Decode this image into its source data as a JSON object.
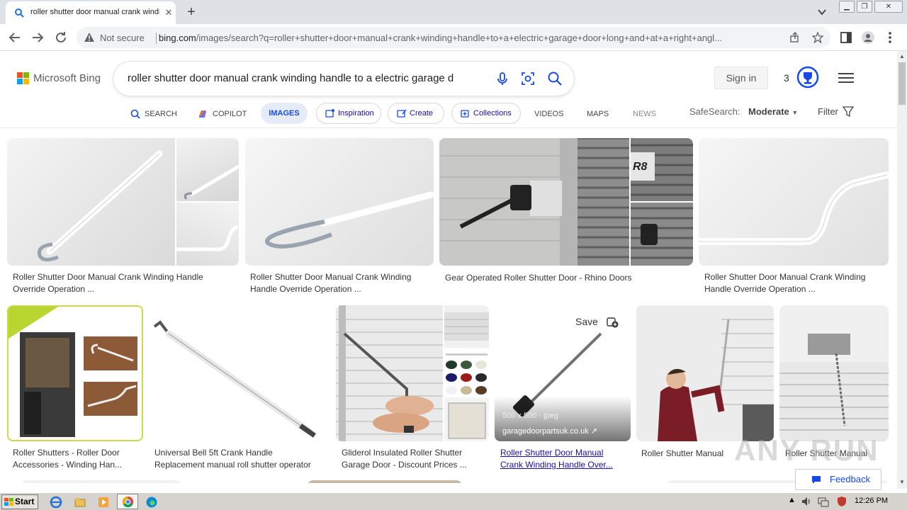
{
  "browser": {
    "tab_title": "roller shutter door manual crank winding handle to a electric garage door long and at a right angle - Bing images",
    "tab_close": "✕",
    "new_tab": "+",
    "not_secure": "Not secure",
    "url_host": "bing.com",
    "url_rest": "/images/search?q=roller+shutter+door+manual+crank+winding+handle+to+a+electric+garage+door+long+and+at+a+right+angl..."
  },
  "bing": {
    "logo_text": "Microsoft Bing",
    "query": "roller shutter door manual crank winding handle to a electric garage d",
    "sign_in": "Sign in",
    "rewards_count": "3",
    "scopes": {
      "search": "SEARCH",
      "copilot": "COPILOT",
      "images": "IMAGES",
      "inspiration": "Inspiration",
      "create": "Create",
      "collections": "Collections",
      "videos": "VIDEOS",
      "maps": "MAPS",
      "news": "NEWS"
    },
    "safesearch_label": "SafeSearch:",
    "safesearch_value": "Moderate",
    "filter_label": "Filter"
  },
  "results": [
    {
      "line1": "Roller Shutter Door Manual Crank Winding Handle",
      "line2": "Override Operation ..."
    },
    {
      "line1": "Roller Shutter Door Manual Crank Winding",
      "line2": "Handle Override Operation ..."
    },
    {
      "line1": "Gear Operated Roller Shutter Door - Rhino Doors",
      "line2": ""
    },
    {
      "line1": "Roller Shutter Door Manual Crank Winding",
      "line2": "Handle Override Operation ..."
    },
    {
      "line1": "Roller Shutters - Roller Door",
      "line2": "Accessories - Winding Han..."
    },
    {
      "line1": "Universal Bell 5ft Crank Handle",
      "line2": "Replacement manual roll shutter operator"
    },
    {
      "line1": "Gliderol Insulated Roller Shutter",
      "line2": "Garage Door - Discount Prices ..."
    },
    {
      "line1": "Roller Shutter Door Manual",
      "line2": "Crank Winding Handle Over..."
    },
    {
      "line1": "Roller Shutter Manual",
      "line2": ""
    },
    {
      "line1": "Roller Shutter Manual",
      "line2": ""
    }
  ],
  "hover": {
    "save_label": "Save",
    "dims": "500 x 500 · jpeg",
    "domain": "garagedoorpartsuk.co.uk"
  },
  "image_text": {
    "r8": "R8"
  },
  "feedback_label": "Feedback",
  "watermark": "ANY RUN",
  "taskbar": {
    "start_label": "Start",
    "clock": "12:26 PM"
  },
  "colors": {
    "bing_blue": "#174ae4",
    "link": "#1a0dab"
  }
}
